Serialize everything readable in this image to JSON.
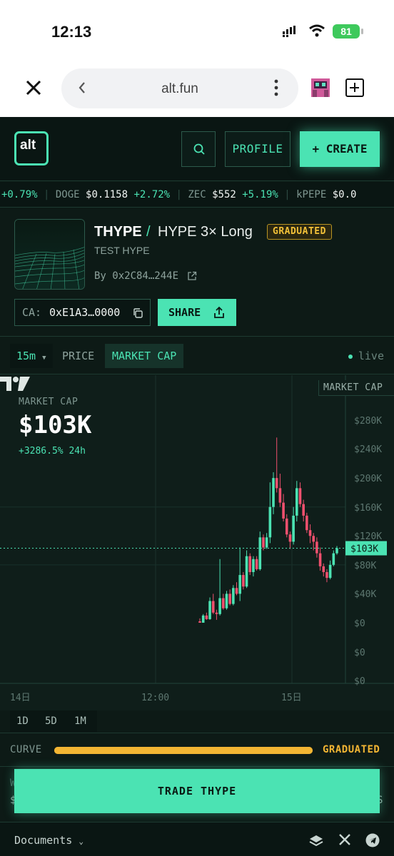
{
  "status_bar": {
    "time": "12:13",
    "battery": "81"
  },
  "browser": {
    "url": "alt.fun"
  },
  "header": {
    "logo": "alt",
    "profile_label": "PROFILE",
    "create_label": "+ CREATE"
  },
  "ticker": [
    {
      "symbol": "",
      "price": "",
      "change": "+0.79%"
    },
    {
      "symbol": "DOGE",
      "price": "$0.1158",
      "change": "+2.72%"
    },
    {
      "symbol": "ZEC",
      "price": "$552",
      "change": "+5.19%"
    },
    {
      "symbol": "kPEPE",
      "price": "$0.0",
      "change": ""
    }
  ],
  "token": {
    "symbol": "THYPE",
    "slash": "/",
    "name": "HYPE 3× Long",
    "badge": "GRADUATED",
    "description": "TEST HYPE",
    "creator": "By 0x2C84…244E",
    "ca_label": "CA:",
    "ca_value": "0xE1A3…0000",
    "share_label": "SHARE"
  },
  "chart_tabs": {
    "timeframe": "15m",
    "price": "PRICE",
    "market_cap": "MARKET CAP",
    "live": "live"
  },
  "chart": {
    "axis_title": "MARKET CAP",
    "label": "MARKET CAP",
    "value": "$103K",
    "change": "+3286.5% 24h",
    "current_tag": "$103K"
  },
  "chart_data": {
    "type": "candlestick",
    "y_ticks": [
      "$280K",
      "$240K",
      "$200K",
      "$160K",
      "$120K",
      "$80K",
      "$40K",
      "$0",
      "$0",
      "$0"
    ],
    "x_ticks": [
      "14日",
      "12:00",
      "15日"
    ],
    "ylim": [
      0,
      280
    ],
    "units": "$K",
    "current_value": 103,
    "candles": [
      [
        2,
        0,
        6,
        0
      ],
      [
        0,
        10,
        12,
        0
      ],
      [
        10,
        5,
        14,
        4
      ],
      [
        5,
        30,
        35,
        4
      ],
      [
        30,
        14,
        40,
        12
      ],
      [
        14,
        12,
        18,
        4
      ],
      [
        12,
        34,
        88,
        10
      ],
      [
        34,
        20,
        40,
        18
      ],
      [
        20,
        40,
        44,
        18
      ],
      [
        40,
        26,
        46,
        24
      ],
      [
        26,
        48,
        52,
        24
      ],
      [
        48,
        40,
        56,
        38
      ],
      [
        40,
        66,
        104,
        30
      ],
      [
        66,
        50,
        70,
        46
      ],
      [
        50,
        92,
        100,
        48
      ],
      [
        92,
        70,
        96,
        66
      ],
      [
        70,
        88,
        92,
        64
      ],
      [
        88,
        74,
        92,
        72
      ],
      [
        74,
        118,
        126,
        72
      ],
      [
        118,
        104,
        122,
        100
      ],
      [
        104,
        118,
        124,
        102
      ],
      [
        118,
        160,
        194,
        110
      ],
      [
        160,
        200,
        208,
        150
      ],
      [
        200,
        186,
        256,
        180
      ],
      [
        186,
        166,
        206,
        160
      ],
      [
        166,
        144,
        178,
        140
      ],
      [
        144,
        122,
        150,
        118
      ],
      [
        122,
        112,
        126,
        102
      ],
      [
        112,
        148,
        160,
        108
      ],
      [
        148,
        186,
        196,
        140
      ],
      [
        186,
        164,
        194,
        160
      ],
      [
        164,
        148,
        170,
        140
      ],
      [
        148,
        128,
        152,
        124
      ],
      [
        128,
        120,
        136,
        110
      ],
      [
        120,
        112,
        124,
        100
      ],
      [
        112,
        96,
        118,
        90
      ],
      [
        96,
        78,
        104,
        72
      ],
      [
        78,
        70,
        82,
        64
      ],
      [
        70,
        62,
        74,
        56
      ],
      [
        62,
        80,
        86,
        60
      ],
      [
        80,
        96,
        100,
        78
      ],
      [
        96,
        103,
        106,
        94
      ]
    ]
  },
  "ranges": [
    "1D",
    "5D",
    "1M"
  ],
  "curve": {
    "label": "CURVE",
    "progress": 1.0,
    "status": "GRADUATED"
  },
  "under": {
    "left": "W",
    "left2": "$",
    "right": "S"
  },
  "trade_label": "TRADE THYPE",
  "footer": {
    "docs": "Documents"
  },
  "colors": {
    "accent": "#4be3b3",
    "up": "#4be3b3",
    "down": "#f0506e",
    "gold": "#f2b533",
    "bg": "#0d1a16"
  }
}
